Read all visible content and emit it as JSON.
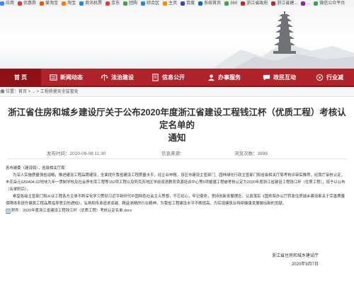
{
  "bookmarks": [
    {
      "label": "应用",
      "color": "#4285f4"
    },
    {
      "label": "优惠券",
      "color": "#e53935"
    },
    {
      "label": "爱淘宝",
      "color": "#ff5000"
    },
    {
      "label": "淘宝",
      "color": "#ff7a00"
    },
    {
      "label": "商讯机票",
      "color": "#1e88e5"
    },
    {
      "label": "京东",
      "color": "#e53935"
    },
    {
      "label": "团购",
      "color": "#43a047"
    },
    {
      "label": "综合区",
      "color": "#1e88e5"
    },
    {
      "label": "主页",
      "color": "#fb8c00"
    },
    {
      "label": "百度",
      "color": "#3949ab"
    },
    {
      "label": "系统首页",
      "color": "#1565c0"
    },
    {
      "label": "360",
      "color": "#43a047"
    },
    {
      "label": "浙江省政府",
      "color": "#c62828"
    },
    {
      "label": "浙江省建...",
      "color": "#c62828"
    },
    {
      "label": "...",
      "color": "#8e24aa"
    },
    {
      "label": "微信公众平台",
      "color": "#43a047"
    }
  ],
  "nav": {
    "home": "首 页",
    "items": [
      {
        "label": "新闻动态",
        "icon": "news-icon"
      },
      {
        "label": "法治建设",
        "icon": "law-icon"
      },
      {
        "label": "信息公开",
        "icon": "info-icon"
      },
      {
        "label": "办事服务",
        "icon": "service-icon"
      },
      {
        "label": "政民互动",
        "icon": "chat-icon"
      },
      {
        "label": "行业减",
        "icon": "industry-icon"
      }
    ]
  },
  "breadcrumb": {
    "prefix": "位置：首页 > ... >",
    "current": "工程质量安全监管处"
  },
  "article": {
    "title_line1": "浙江省住房和城乡建设厅关于公布2020年度浙江省建设工程钱江杯（优质工程）考核认定名单的",
    "title_line2": "通知",
    "publish_time": "发布时间：2020-09-08 11:30",
    "source": "信息来源：",
    "views": "浏览次数：3999",
    "salutation": "各市建委（建设局），省级相关厅局：",
    "para1": "为深入实施质量强省战略，推进建设工程品牌建设，全面提升我省建设工程质量水平，经企业申报，设区市建设主管部门、园林绿化行政主管部门和省级相关厅局考核评审后推荐，经我厅审核认定，丰花朵元G50404-02地块九年一贯制学校及社会停车库工程等152项工程以及阿克苏地区学前双语教育资源培训中心等5项援疆工程被考核认定为2020年度浙江省建设工程钱江杯（优质工程），现予以公布（名单附后）。",
    "para2": "希望各级主管部门和从业工程各方主体不断深化学习贯彻习近平新时代中国特色社会主义思想，不忘初心，牢记使命，坚持创新发展理念，认真落实《国务院办公厅转发住房城乡建设部关于完善质量保障体系提升建筑工程品质指导意见的通知》，弘扬和传承追求卓越、精益求精的行业精神，为我省工程建设水平不断提高，为实现建筑业持续健康发展做出新的贡献。",
    "attachment": "附件：2020年度浙江省建设工程钱江杯（优质工程）考核认定名单.docx",
    "signer": "浙江省住房和城乡建设厅",
    "date": "2020年9月7日"
  }
}
